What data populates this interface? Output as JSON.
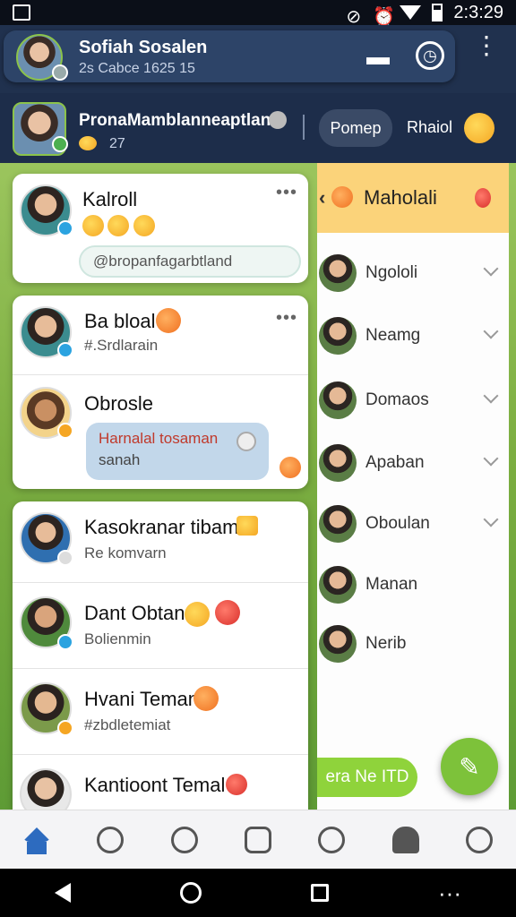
{
  "status_bar": {
    "time": "2:3:29"
  },
  "header_primary": {
    "name": "Sofiah Sosalen",
    "subtitle": "2s Cabce 1625 15"
  },
  "header_secondary": {
    "name": "PronaMamblanneaptlan",
    "count": "27",
    "button_label": "Pomep",
    "link_label": "Rhaiol"
  },
  "right_panel": {
    "title": "Maholali",
    "items": [
      {
        "name": "Ngololi"
      },
      {
        "name": "Neamg"
      },
      {
        "name": "Domaos"
      },
      {
        "name": "Apaban"
      },
      {
        "name": "Oboulan"
      },
      {
        "name": "Manan"
      },
      {
        "name": "Nerib"
      }
    ],
    "cta_label": "era Ne ITD"
  },
  "chat_card_1": {
    "name": "Kalroll",
    "field_value": "@bropanfagarbtland"
  },
  "chat_card_2": {
    "rows": [
      {
        "name": "Ba bloal",
        "sub": "#.Srdlarain"
      },
      {
        "name": "Obrosle",
        "bubble_line1": "Harnalal tosaman",
        "bubble_line2": "sanah"
      }
    ]
  },
  "chat_card_3": {
    "rows": [
      {
        "name": "Kasokranar tibam",
        "sub": "Re komvarn"
      },
      {
        "name": "Dant Obtan",
        "sub": "Bolienmin"
      },
      {
        "name": "Hvani Teman",
        "sub": "#zbdletemiat"
      },
      {
        "name": "Kantioont Temal",
        "sub": ""
      }
    ]
  },
  "bottom_nav": [
    "home-icon",
    "profile-icon",
    "groups-icon",
    "gallery-icon",
    "chat-icon",
    "bell-icon",
    "emoji-icon"
  ]
}
